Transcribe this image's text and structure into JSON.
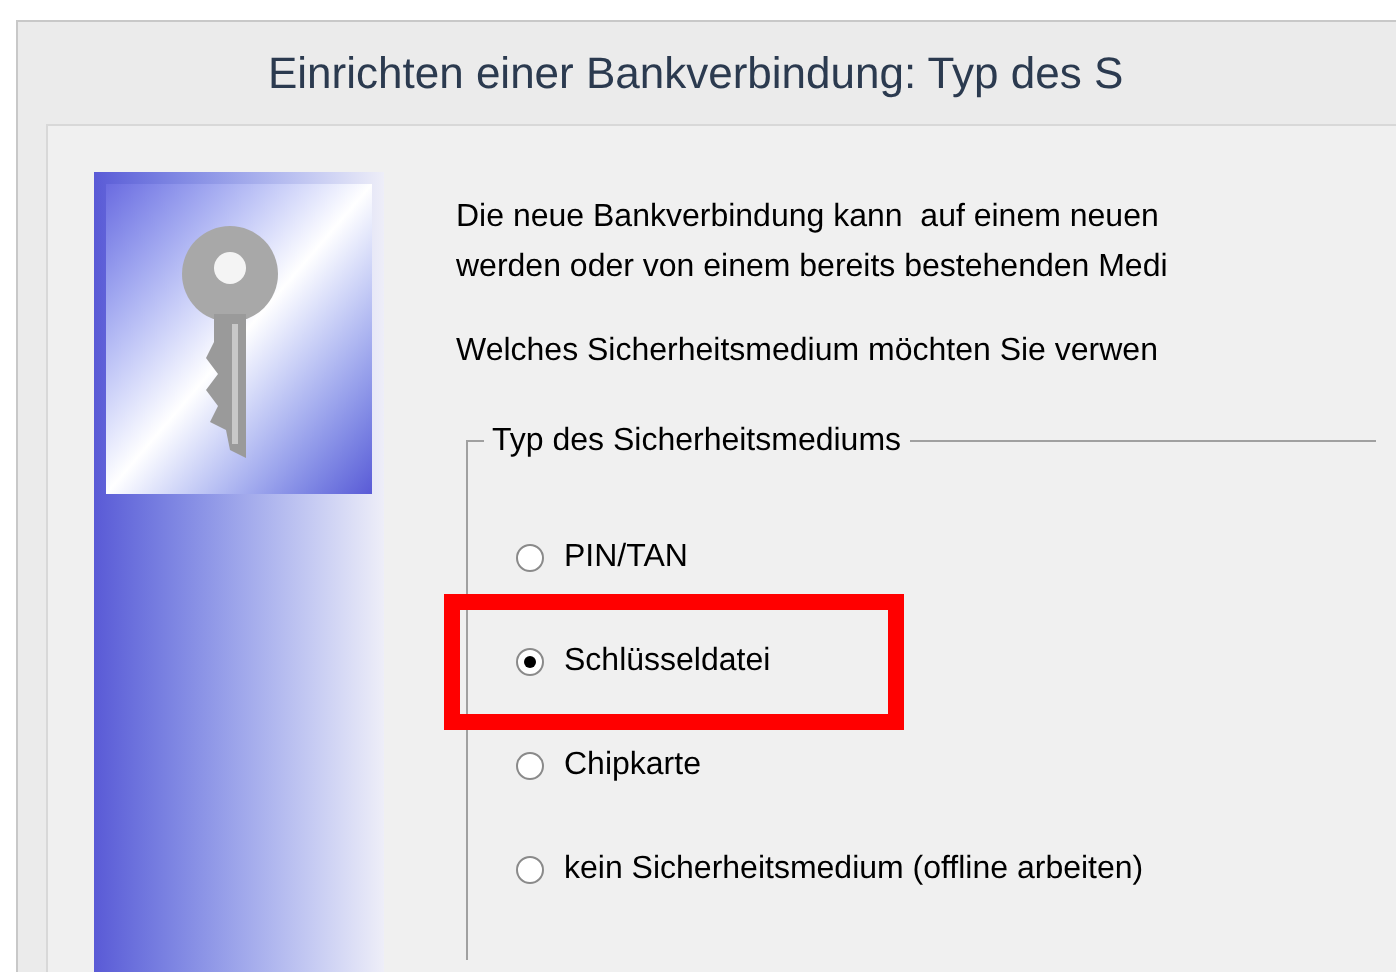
{
  "window": {
    "title": "Einrichten einer Bankverbindung: Typ des S"
  },
  "intro": [
    "Die neue Bankverbindung kann  auf einem neuen",
    "werden oder von einem bereits bestehenden Medi"
  ],
  "question": "Welches Sicherheitsmedium möchten Sie verwen",
  "group": {
    "legend": "Typ des Sicherheitsmediums",
    "options": [
      {
        "label": "PIN/TAN",
        "selected": false,
        "highlighted": false
      },
      {
        "label": "Schlüsseldatei",
        "selected": true,
        "highlighted": true
      },
      {
        "label": "Chipkarte",
        "selected": false,
        "highlighted": false
      },
      {
        "label": "kein Sicherheitsmedium (offline arbeiten)",
        "selected": false,
        "highlighted": false
      }
    ]
  }
}
